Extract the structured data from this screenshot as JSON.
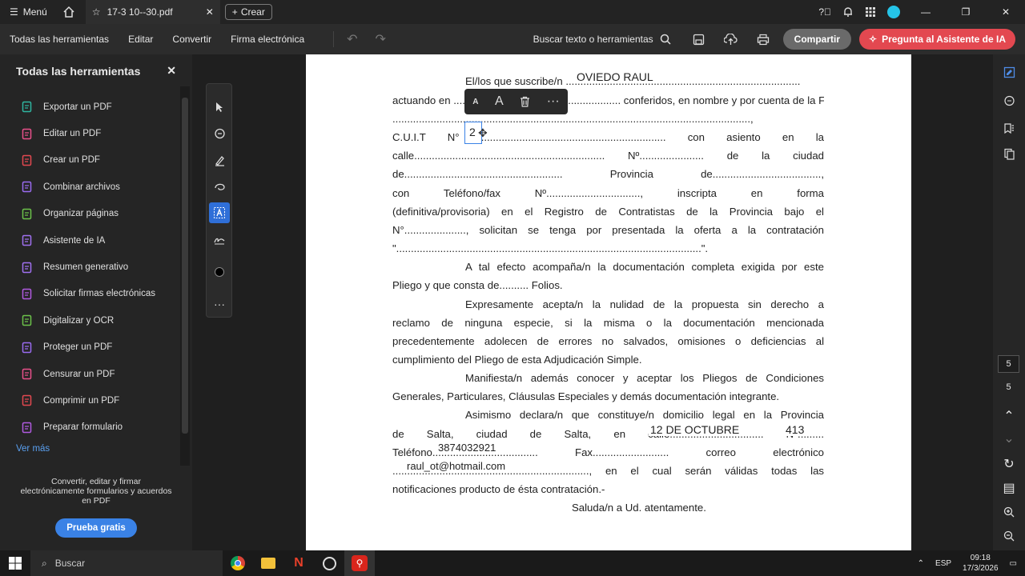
{
  "titlebar": {
    "menu_label": "Menú",
    "tab_title": "17-3 10--30.pdf",
    "create_label": "Crear"
  },
  "menubar": {
    "items": [
      "Todas las herramientas",
      "Editar",
      "Convertir",
      "Firma electrónica"
    ],
    "search_label": "Buscar texto o herramientas",
    "share_label": "Compartir",
    "ai_label": "Pregunta al Asistente de IA"
  },
  "left_panel": {
    "title": "Todas las herramientas",
    "tools": [
      {
        "label": "Exportar un PDF",
        "color": "#2fb5a0",
        "icon": "export-pdf-icon"
      },
      {
        "label": "Editar un PDF",
        "color": "#e8508a",
        "icon": "edit-pdf-icon"
      },
      {
        "label": "Crear un PDF",
        "color": "#e34850",
        "icon": "create-pdf-icon"
      },
      {
        "label": "Combinar archivos",
        "color": "#9a6bf0",
        "icon": "combine-files-icon"
      },
      {
        "label": "Organizar páginas",
        "color": "#6cc24a",
        "icon": "organize-pages-icon"
      },
      {
        "label": "Asistente de IA",
        "color": "#a070f0",
        "icon": "ai-assistant-icon"
      },
      {
        "label": "Resumen generativo",
        "color": "#a070f0",
        "icon": "generative-summary-icon"
      },
      {
        "label": "Solicitar firmas electrónicas",
        "color": "#b05ae0",
        "icon": "request-signatures-icon"
      },
      {
        "label": "Digitalizar y OCR",
        "color": "#6cc24a",
        "icon": "scan-ocr-icon"
      },
      {
        "label": "Proteger un PDF",
        "color": "#9a6bf0",
        "icon": "protect-pdf-icon"
      },
      {
        "label": "Censurar un PDF",
        "color": "#e8508a",
        "icon": "redact-pdf-icon"
      },
      {
        "label": "Comprimir un PDF",
        "color": "#e34850",
        "icon": "compress-pdf-icon"
      },
      {
        "label": "Preparar formulario",
        "color": "#b05ae0",
        "icon": "prepare-form-icon"
      }
    ],
    "more_label": "Ver más",
    "promo_text": "Convertir, editar y firmar electrónicamente formularios y acuerdos en PDF",
    "trial_label": "Prueba gratis"
  },
  "document": {
    "lines": [
      "El/los que suscribe/n ................................................................................",
      "actuando en ......................................................... conferidos, en nombre y por cuenta de la Firma",
      "..........................................................................................................................,",
      "C.U.I.T N° ............................................................... con asiento en la",
      "calle................................................................. Nº...................... de la ciudad",
      "de...................................................... Provincia de.....................................,",
      "con Teléfono/fax Nº................................, inscripta en forma",
      "(definitiva/provisoria) en el Registro de Contratistas de la Provincia bajo el",
      "N°....................., solicitan se tenga por presentada la oferta a la contratación",
      "\"........................................................................................................\".",
      "A tal efecto acompaña/n la documentación completa exigida por este",
      "Pliego y que consta de.......... Folios.",
      "Expresamente acepta/n la nulidad de la propuesta sin derecho a",
      "reclamo de ninguna especie, si la misma o la documentación mencionada",
      "precedentemente adolecen de errores no salvados, omisiones o deficiencias al",
      "cumplimiento del Pliego de esta Adjudicación Simple.",
      "Manifiesta/n además conocer y aceptar los Pliegos de Condiciones",
      "Generales, Particulares, Cláusulas Especiales y demás documentación integrante.",
      "Asimismo declara/n que constituye/n domicilio legal en la Provincia",
      "de Salta, ciudad de Salta, en calle................................ Nº.........",
      "Teléfono.................................... Fax.......................... correo electrónico",
      "..................................................................., en el cual serán válidas todas las",
      "notificaciones producto de ésta contratación.-",
      "Saluda/n a Ud. atentamente."
    ],
    "fills": {
      "name": "OVIEDO RAUL",
      "cuit": "2",
      "street": "12 DE OCTUBRE",
      "number": "413",
      "phone": "3874032921",
      "email": "raul_ot@hotmail.com"
    }
  },
  "right_rail": {
    "page_current": "5",
    "page_total": "5"
  },
  "taskbar": {
    "search_label": "Buscar",
    "language": "ESP",
    "time": "09:18",
    "date": "17/3/2026"
  }
}
